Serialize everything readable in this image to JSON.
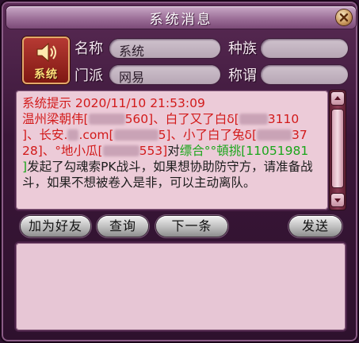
{
  "window": {
    "title": "系统消息",
    "emblem_label": "系统"
  },
  "info": {
    "name_label": "名称",
    "name_value": "系统",
    "race_label": "种族",
    "race_value": "",
    "school_label": "门派",
    "school_value": "网易",
    "title_label": "称谓",
    "title_value": ""
  },
  "message": {
    "header": "系统提示 2020/11/10 21:53:09",
    "l1": "温州梁朝伟[",
    "l1b": "560]、白了又了白δ[",
    "l1c": "3110",
    "l2": "]、长安.",
    "l2b": ".com[",
    "l2c": "5]、小了白了兔δ[",
    "l2d": "37",
    "l3": "28]、°地小瓜[",
    "l3b": "553]",
    "l3c": "对",
    "g1": "缥合°°頓挑[11051981",
    "g2": "]",
    "tail": "发起了勾魂索PK战斗，如果想协助防守方，请准备战斗，如果不想被卷入是非，可以主动离队。"
  },
  "buttons": {
    "add_friend": "加为好友",
    "query": "查询",
    "next": "下一条",
    "send": "发送"
  },
  "input": {
    "value": ""
  },
  "colors": {
    "accent_red": "#d21a1a",
    "accent_green": "#1aa61a",
    "panel": "#eccbd8"
  }
}
